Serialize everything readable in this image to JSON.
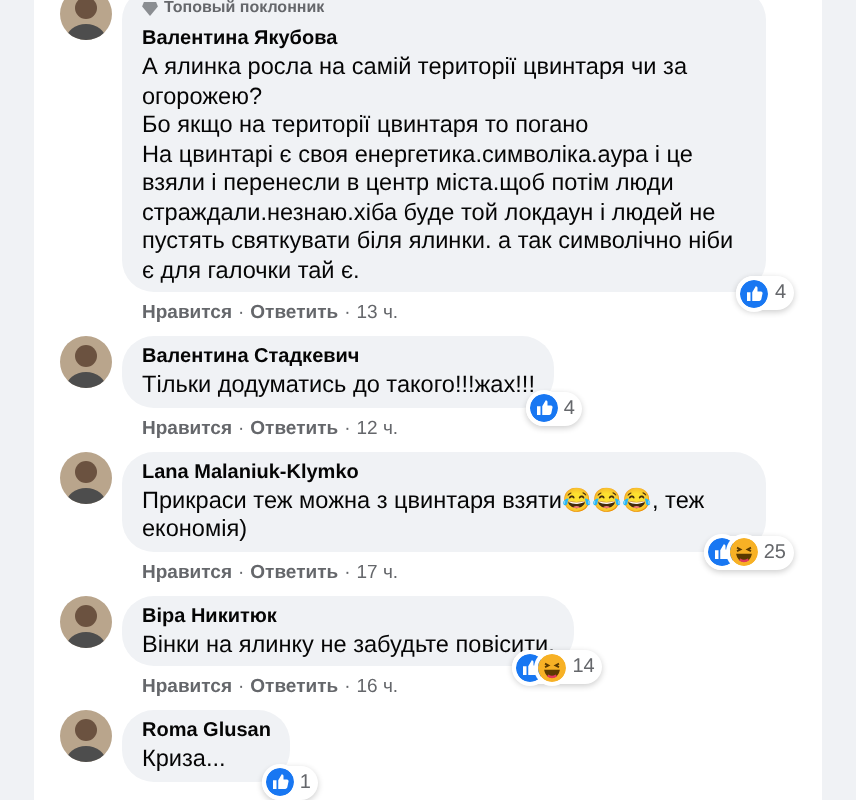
{
  "comments": [
    {
      "badge": "Топовый поклонник",
      "author": "Валентина Якубова",
      "paragraphs": [
        "А ялинка росла на самій території цвинтаря чи за огорожею?",
        "Бо якщо на території цвинтаря то погано",
        "На цвинтарі є своя енергетика.символіка.аура і це взяли і перенесли в центр міста.щоб потім люди страждали.незнаю.хіба буде той локдаун і людей не пустять святкувати біля ялинки. а так символічно ніби є для галочки тай є."
      ],
      "reactions": [
        {
          "kind": "like"
        }
      ],
      "reaction_count": "4",
      "actions": [
        {
          "kind": "like",
          "text": "Нравится"
        },
        {
          "kind": "dot",
          "text": "·"
        },
        {
          "kind": "reply",
          "text": "Ответить"
        },
        {
          "kind": "dot",
          "text": "·"
        },
        {
          "kind": "time",
          "text": "13 ч."
        }
      ]
    },
    {
      "author": "Валентина Стадкевич",
      "paragraphs": [
        "Тільки додуматись до такого!!!жах!!!"
      ],
      "reactions": [
        {
          "kind": "like"
        }
      ],
      "reaction_count": "4",
      "actions": [
        {
          "kind": "like",
          "text": "Нравится"
        },
        {
          "kind": "dot",
          "text": "·"
        },
        {
          "kind": "reply",
          "text": "Ответить"
        },
        {
          "kind": "dot",
          "text": "·"
        },
        {
          "kind": "time",
          "text": "12 ч."
        }
      ]
    },
    {
      "author": "Lana Malaniuk-Klymko",
      "paragraphs": [
        "Прикраси теж можна з цвинтаря взяти😂😂😂, теж економія)"
      ],
      "reactions": [
        {
          "kind": "like"
        },
        {
          "kind": "haha"
        }
      ],
      "reaction_count": "25",
      "actions": [
        {
          "kind": "like",
          "text": "Нравится"
        },
        {
          "kind": "dot",
          "text": "·"
        },
        {
          "kind": "reply",
          "text": "Ответить"
        },
        {
          "kind": "dot",
          "text": "·"
        },
        {
          "kind": "time",
          "text": "17 ч."
        }
      ]
    },
    {
      "author": "Віра Никитюк",
      "paragraphs": [
        "Вінки на ялинку не забудьте повісити."
      ],
      "reactions": [
        {
          "kind": "like"
        },
        {
          "kind": "haha"
        }
      ],
      "reaction_count": "14",
      "actions": [
        {
          "kind": "like",
          "text": "Нравится"
        },
        {
          "kind": "dot",
          "text": "·"
        },
        {
          "kind": "reply",
          "text": "Ответить"
        },
        {
          "kind": "dot",
          "text": "·"
        },
        {
          "kind": "time",
          "text": "16 ч."
        }
      ]
    },
    {
      "author": "Roma Glusan",
      "paragraphs": [
        "Криза..."
      ],
      "reactions": [
        {
          "kind": "like"
        }
      ],
      "reaction_count": "1"
    }
  ]
}
